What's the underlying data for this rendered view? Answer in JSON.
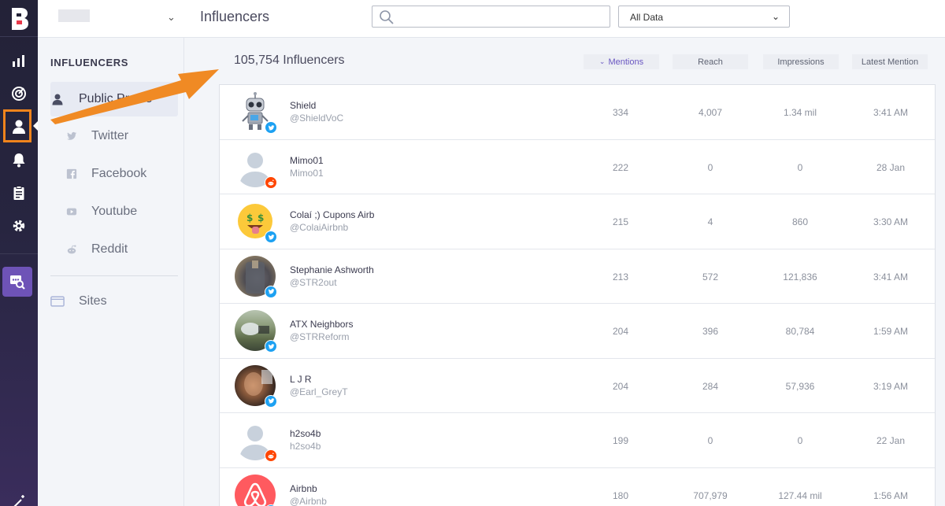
{
  "colors": {
    "accent": "#6a57c2",
    "highlight": "#f0841c",
    "twitter": "#1da1f2",
    "reddit": "#ff4500"
  },
  "header": {
    "title": "Influencers",
    "search_placeholder": "",
    "filter_value": "All Data"
  },
  "sidebar": {
    "section_title": "INFLUENCERS",
    "items": [
      {
        "label": "Public Profile",
        "icon": "user-icon"
      },
      {
        "label": "Twitter",
        "icon": "twitter-icon"
      },
      {
        "label": "Facebook",
        "icon": "facebook-icon"
      },
      {
        "label": "Youtube",
        "icon": "youtube-icon"
      },
      {
        "label": "Reddit",
        "icon": "reddit-icon"
      },
      {
        "label": "Sites",
        "icon": "browser-icon"
      }
    ]
  },
  "main": {
    "count_label": "105,754 Influencers",
    "columns": [
      {
        "label": "Mentions",
        "sorted": true
      },
      {
        "label": "Reach",
        "sorted": false
      },
      {
        "label": "Impressions",
        "sorted": false
      },
      {
        "label": "Latest Mention",
        "sorted": false
      }
    ],
    "rows": [
      {
        "name": "Shield",
        "handle": "@ShieldVoC",
        "mentions": "334",
        "reach": "4,007",
        "impressions": "1.34 mil",
        "latest": "3:41 AM",
        "network": "twitter",
        "avatar": "robot"
      },
      {
        "name": "Mimo01",
        "handle": "Mimo01",
        "mentions": "222",
        "reach": "0",
        "impressions": "0",
        "latest": "28 Jan",
        "network": "reddit",
        "avatar": "default"
      },
      {
        "name": "Colaí ;) Cupons Airb",
        "handle": "@ColaiAirbnb",
        "mentions": "215",
        "reach": "4",
        "impressions": "860",
        "latest": "3:30 AM",
        "network": "twitter",
        "avatar": "emoji"
      },
      {
        "name": "Stephanie Ashworth",
        "handle": "@STR2out",
        "mentions": "213",
        "reach": "572",
        "impressions": "121,836",
        "latest": "3:41 AM",
        "network": "twitter",
        "avatar": "photo"
      },
      {
        "name": "ATX Neighbors",
        "handle": "@STRReform",
        "mentions": "204",
        "reach": "396",
        "impressions": "80,784",
        "latest": "1:59 AM",
        "network": "twitter",
        "avatar": "photo"
      },
      {
        "name": "L J R",
        "handle": "@Earl_GreyT",
        "mentions": "204",
        "reach": "284",
        "impressions": "57,936",
        "latest": "3:19 AM",
        "network": "twitter",
        "avatar": "photo"
      },
      {
        "name": "h2so4b",
        "handle": "h2so4b",
        "mentions": "199",
        "reach": "0",
        "impressions": "0",
        "latest": "22 Jan",
        "network": "reddit",
        "avatar": "default"
      },
      {
        "name": "Airbnb",
        "handle": "@Airbnb",
        "mentions": "180",
        "reach": "707,979",
        "impressions": "127.44 mil",
        "latest": "1:56 AM",
        "network": "twitter",
        "avatar": "airbnb"
      }
    ]
  }
}
